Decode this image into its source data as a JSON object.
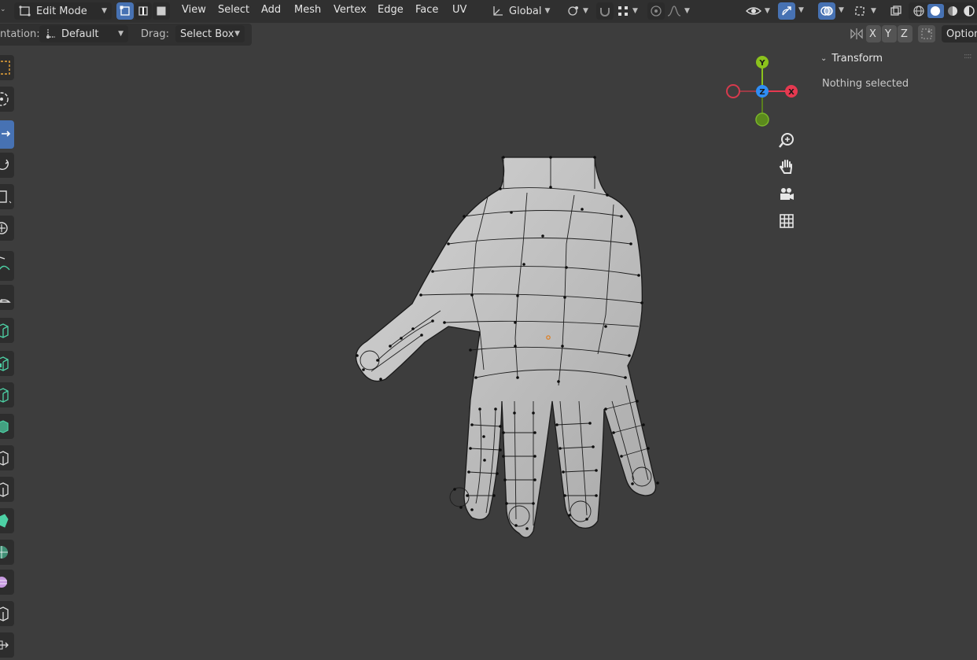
{
  "header": {
    "mode_label": "Edit Mode",
    "menus": [
      "View",
      "Select",
      "Add",
      "Mesh",
      "Vertex",
      "Edge",
      "Face",
      "UV"
    ],
    "orientation": "Global"
  },
  "tool_settings": {
    "orientation_label": "ntation:",
    "orientation_value": "Default",
    "drag_label": "Drag:",
    "drag_value": "Select Box",
    "axis_x": "X",
    "axis_y": "Y",
    "axis_z": "Z",
    "options_label": "Option"
  },
  "sidebar": {
    "panel_title": "Transform",
    "panel_body": "Nothing selected"
  },
  "gizmo": {
    "x_label": "X",
    "y_label": "Y",
    "z_label": "Z",
    "colors": {
      "x": "#e63950",
      "y": "#8bc21c",
      "z": "#2f8ef5"
    }
  },
  "icons": {
    "navigation": [
      "zoom-icon",
      "pan-hand-icon",
      "camera-icon",
      "grid-icon"
    ],
    "toolbar": [
      "select-box-icon",
      "cursor-icon",
      "move-icon",
      "rotate-icon",
      "scale-icon",
      "transform-icon",
      "annotate-icon",
      "measure-icon",
      "add-cube-icon",
      "extrude-icon",
      "inset-icon",
      "bevel-icon",
      "loop-cut-icon",
      "knife-icon",
      "poly-build-icon",
      "spin-icon",
      "smooth-icon",
      "shrink-fatten-icon",
      "shear-icon",
      "rip-icon"
    ]
  },
  "colors": {
    "accent": "#4772b3",
    "header_bg": "#303030",
    "viewport_bg": "#3d3d3d"
  }
}
